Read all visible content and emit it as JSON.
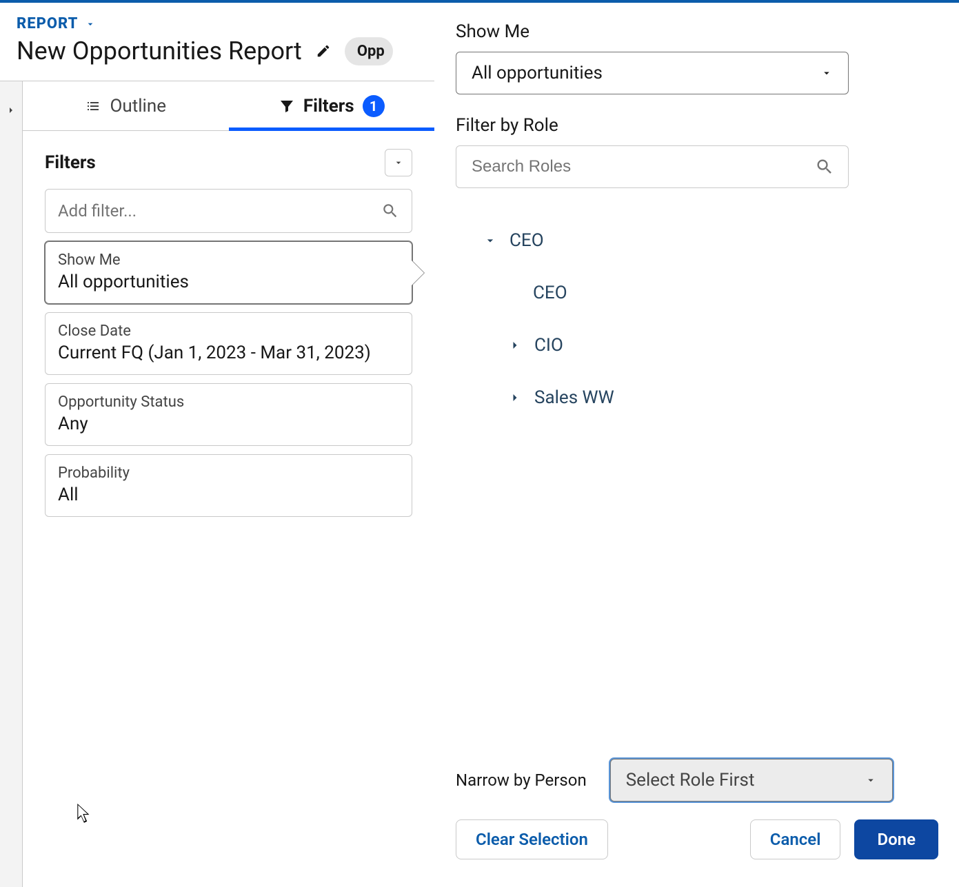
{
  "header": {
    "eyebrow": "REPORT",
    "title": "New Opportunities Report",
    "pill": "Opp"
  },
  "tabs": {
    "outline": "Outline",
    "filters": "Filters",
    "badge": "1"
  },
  "filtersPanel": {
    "heading": "Filters",
    "addPlaceholder": "Add filter...",
    "cards": [
      {
        "label": "Show Me",
        "value": "All opportunities"
      },
      {
        "label": "Close Date",
        "value": "Current FQ (Jan 1, 2023 - Mar 31, 2023)"
      },
      {
        "label": "Opportunity Status",
        "value": "Any"
      },
      {
        "label": "Probability",
        "value": "All"
      }
    ]
  },
  "flyout": {
    "showMeLabel": "Show Me",
    "showMeValue": "All opportunities",
    "filterByRoleLabel": "Filter by Role",
    "searchPlaceholder": "Search Roles",
    "tree": {
      "root": "CEO",
      "self": "CEO",
      "children": [
        "CIO",
        "Sales WW"
      ]
    },
    "narrowLabel": "Narrow by Person",
    "narrowValue": "Select Role First",
    "clear": "Clear Selection",
    "cancel": "Cancel",
    "done": "Done"
  }
}
